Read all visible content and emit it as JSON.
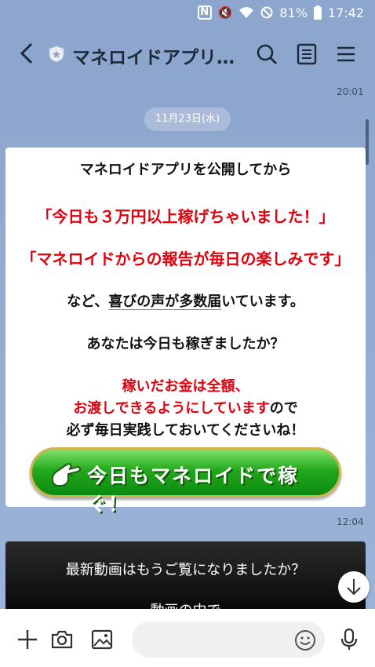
{
  "status_bar": {
    "battery": "81%",
    "time": "17:42",
    "nfc": "N"
  },
  "header": {
    "title": "マネロイドアプリ@…"
  },
  "chat": {
    "time_top": "20:01",
    "date": "11月23日(水)",
    "message1": {
      "line1": "マネロイドアプリを公開してから",
      "line2": "「今日も３万円以上稼げちゃいました！」",
      "line3": "「マネロイドからの報告が毎日の楽しみです」",
      "line4_a": "など、",
      "line4_b": "喜びの声が多数届",
      "line4_c": "いています。",
      "line5": "あなたは今日も稼ぎましたか？",
      "line6": "稼いだお金は全額、",
      "line7_red": "お渡しできるようにしています",
      "line7_black": "ので",
      "line8": "必ず毎日実践しておいてくださいね！",
      "cta_label": "今日もマネロイドで稼ぐ！"
    },
    "time2": "12:04",
    "message2": {
      "line1": "最新動画はもうご覧になりましたか？",
      "line2": "動画の中で"
    }
  },
  "colors": {
    "accent_red": "#e1000e",
    "cta_green": "#24a81c",
    "header_bg": "#8da6cd"
  }
}
